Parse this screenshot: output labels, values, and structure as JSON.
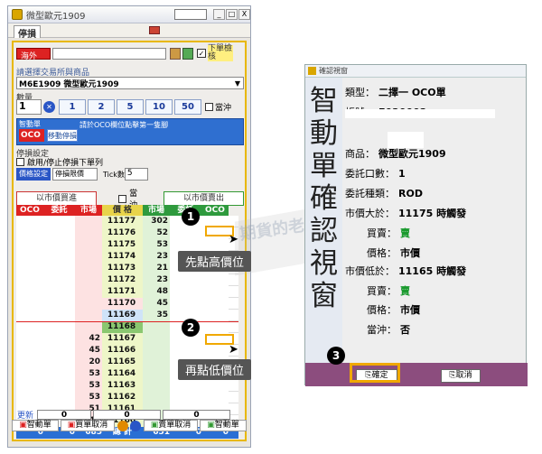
{
  "trade_window": {
    "title": "微型歐元1909",
    "tab_label": "停損",
    "account_selector": "海外",
    "checkbox_label": "下單檢核",
    "exchange_section": "請選擇交易所與商品",
    "product": "M6E1909 微型歐元1909",
    "quantity_label": "數量",
    "quantity_value": "1",
    "qty_buttons": [
      "1",
      "2",
      "5",
      "10",
      "50"
    ],
    "day_trade_label": "當沖",
    "smart_section": "智動單",
    "smart_type": "OCO",
    "move_stop_btn": "移動停損",
    "smart_hint": "請於OCO欄位點擊第一隻腳",
    "stop_section": "停損設定",
    "enable_stop": "啟用/停止停損下單列",
    "price_set_btn": "價格設定",
    "stop_select": "停損限價",
    "tick_label": "Tick數",
    "tick_value": "5",
    "market_buy_btn": "以市價買進",
    "hedge_label": "當沖",
    "market_sell_btn": "以市價賣出",
    "col_headers": [
      "OCO",
      "委託",
      "市場",
      "價 格",
      "市場",
      "委託",
      "OCO"
    ],
    "rows": [
      {
        "bid": "",
        "price": "11177",
        "ask": "302"
      },
      {
        "bid": "",
        "price": "11176",
        "ask": "52"
      },
      {
        "bid": "",
        "price": "11175",
        "ask": "53"
      },
      {
        "bid": "",
        "price": "11174",
        "ask": "23"
      },
      {
        "bid": "",
        "price": "11173",
        "ask": "21"
      },
      {
        "bid": "",
        "price": "11172",
        "ask": "23"
      },
      {
        "bid": "",
        "price": "11171",
        "ask": "48"
      },
      {
        "bid": "",
        "price": "11170",
        "ask": "45"
      },
      {
        "bid": "",
        "price": "11169",
        "ask": "35"
      },
      {
        "bid": "",
        "price": "11168",
        "ask": ""
      },
      {
        "bid": "42",
        "price": "11167",
        "ask": ""
      },
      {
        "bid": "45",
        "price": "11166",
        "ask": ""
      },
      {
        "bid": "20",
        "price": "11165",
        "ask": ""
      },
      {
        "bid": "53",
        "price": "11164",
        "ask": ""
      },
      {
        "bid": "53",
        "price": "11163",
        "ask": ""
      },
      {
        "bid": "53",
        "price": "11162",
        "ask": ""
      },
      {
        "bid": "51",
        "price": "11161",
        "ask": ""
      },
      {
        "bid": "42",
        "price": "11160",
        "ask": ""
      }
    ],
    "total_row": {
      "c1": "0",
      "c2": "0",
      "c3": "685",
      "label": "總 計",
      "c5": "651",
      "c6": "0",
      "c7": "0"
    },
    "update_label": "更新",
    "update_vals": [
      "0",
      "0",
      "0"
    ],
    "footer_buttons": [
      "智動單",
      "買單取消",
      "賣單取消",
      "智動單"
    ]
  },
  "callouts": {
    "c1_num": "1",
    "c1_text": "先點高價位",
    "c2_num": "2",
    "c2_text": "再點低價位",
    "c3_num": "3"
  },
  "watermark": "期貨的老大哥",
  "dialog": {
    "title": "確認視窗",
    "side_title": [
      "智",
      "動",
      "單",
      "確",
      "認",
      "視",
      "窗"
    ],
    "lines": [
      {
        "k": "類型：",
        "v": "二擇一 OCO單"
      },
      {
        "k": "帳號：",
        "v": "F020002"
      },
      {
        "k": "商品：",
        "v": "微型歐元1909"
      },
      {
        "k": "委託口數：",
        "v": "1"
      },
      {
        "k": "委託種類：",
        "v": "ROD"
      },
      {
        "k": "市價大於：",
        "v": "11175 時觸發"
      },
      {
        "k": "買賣：",
        "v": "賣"
      },
      {
        "k": "價格：",
        "v": "市價"
      },
      {
        "k": "市價低於：",
        "v": "11165 時觸發"
      },
      {
        "k": "買賣：",
        "v": "賣"
      },
      {
        "k": "價格：",
        "v": "市價"
      },
      {
        "k": "當沖：",
        "v": "否"
      }
    ],
    "ok_btn": "確定",
    "cancel_btn": "取消"
  }
}
